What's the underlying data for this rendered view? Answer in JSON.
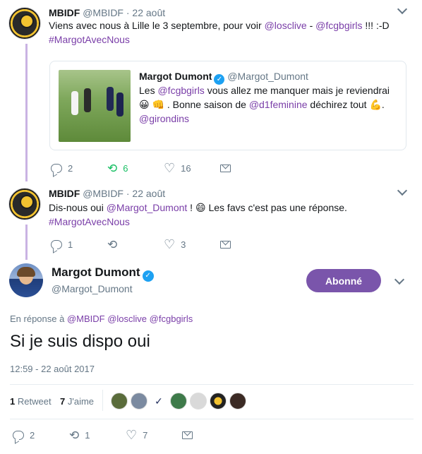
{
  "tweet1": {
    "name": "MBIDF",
    "handle": "@MBIDF",
    "date": "· 22 août",
    "text_prefix": "Viens avec nous à Lille le 3 septembre, pour voir ",
    "mention1": "@losclive",
    "sep": " - ",
    "mention2": "@fcgbgirls",
    "text_suffix": " !!! :-D",
    "hashtag": "#MargotAvecNous",
    "counts": {
      "reply": "2",
      "retweet": "6",
      "like": "16"
    }
  },
  "quote": {
    "name": "Margot Dumont",
    "handle": "@Margot_Dumont",
    "t1": "Les ",
    "m1": "@fcgbgirls",
    "t2": " vous allez me manquer mais je reviendrai ",
    "emoji1": "😀",
    "emoji2": "👊",
    "t3": " . Bonne saison de ",
    "m2": "@d1feminine",
    "t4": " déchirez tout ",
    "emoji3": "💪",
    "t5": ".",
    "m3": "@girondins"
  },
  "tweet2": {
    "name": "MBIDF",
    "handle": "@MBIDF",
    "date": "· 22 août",
    "t1": "Dis-nous oui ",
    "m1": "@Margot_Dumont",
    "t2": " ! ",
    "emoji": "😄",
    "t3": " Les favs c'est pas une réponse.",
    "hashtag": "#MargotAvecNous",
    "counts": {
      "reply": "1",
      "retweet": "",
      "like": "3"
    }
  },
  "main": {
    "name": "Margot Dumont",
    "handle": "@Margot_Dumont",
    "follow_label": "Abonné",
    "reply_prefix": "En réponse à ",
    "reply_to": [
      "@MBIDF",
      "@losclive",
      "@fcgbgirls"
    ],
    "text": "Si je suis dispo oui",
    "timestamp": "12:59 - 22 août 2017",
    "retweet_count": "1",
    "retweet_label": "Retweet",
    "like_count": "7",
    "like_label": "J'aime",
    "counts": {
      "reply": "2",
      "retweet": "1",
      "like": "7"
    }
  },
  "icons": {
    "verified": "verified-badge",
    "reply": "reply-icon",
    "retweet": "retweet-icon",
    "like": "heart-icon",
    "dm": "message-icon"
  },
  "colors": {
    "link": "#7a3ea8",
    "thread": "#c9b3e3",
    "follow": "#7a55ab",
    "retweet_active": "#17bf63"
  }
}
